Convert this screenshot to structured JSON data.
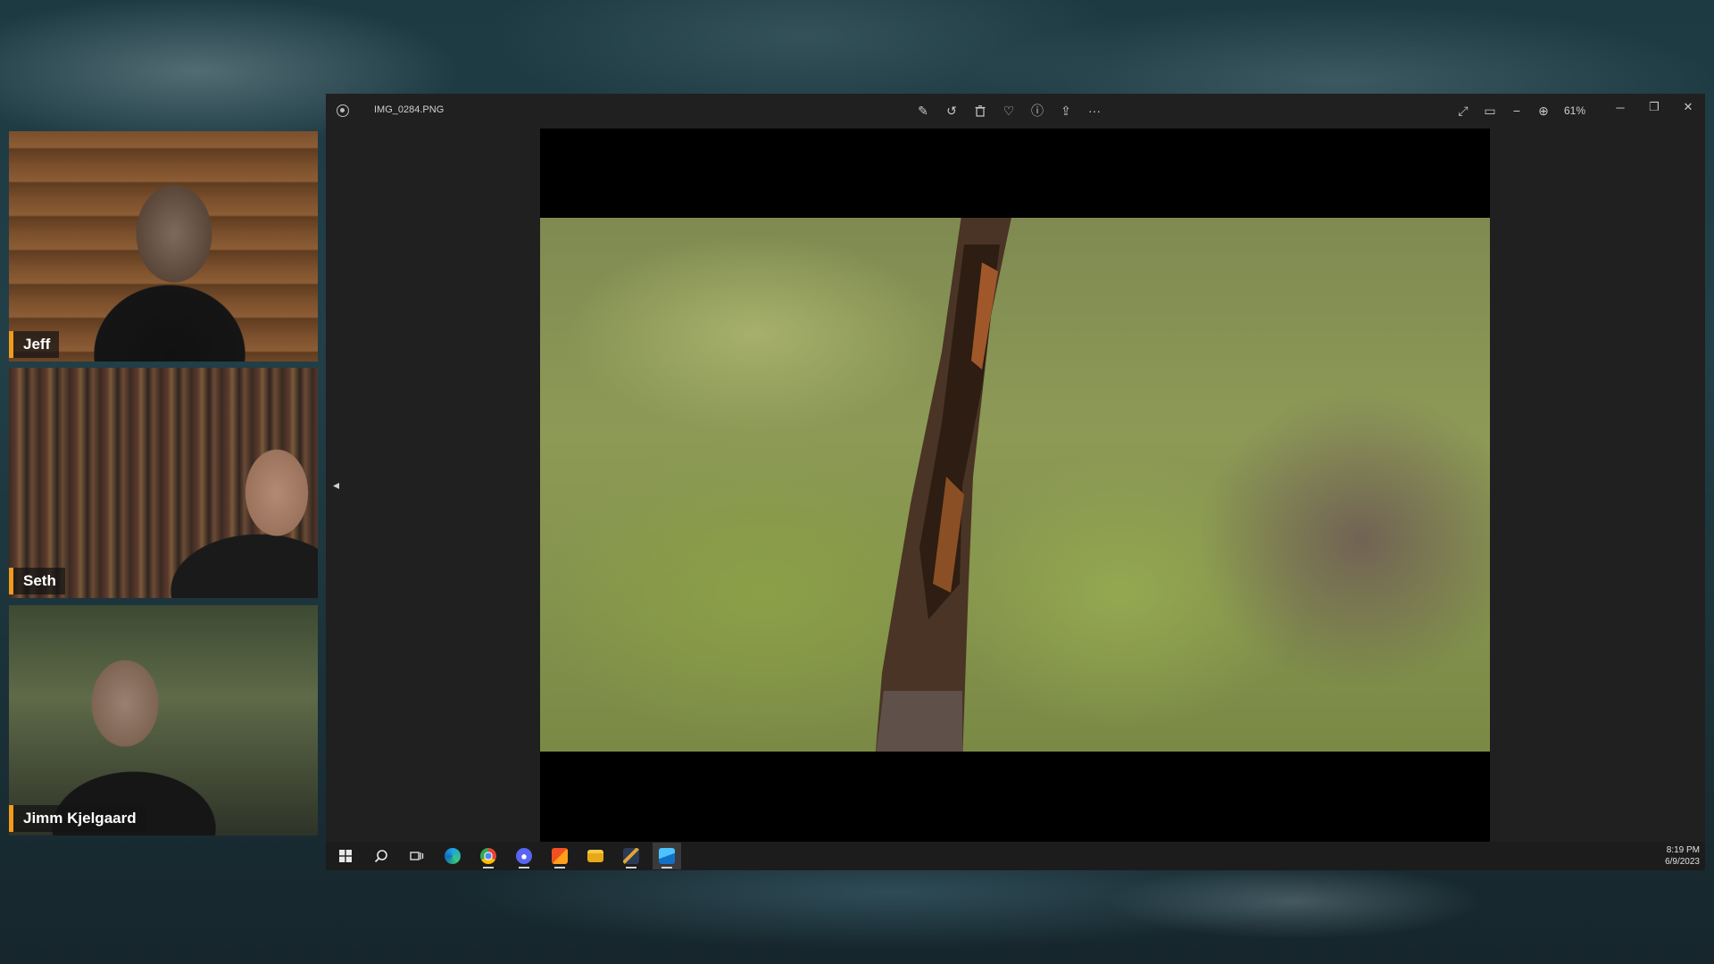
{
  "participants": [
    {
      "name": "Jeff"
    },
    {
      "name": "Seth"
    },
    {
      "name": "Jimm Kjelgaard"
    }
  ],
  "photos_app": {
    "file_name": "IMG_0284.PNG",
    "zoom": "61%",
    "toolbar_icons": [
      "edit-image-icon",
      "rotate-icon",
      "delete-icon",
      "favorite-icon",
      "info-icon",
      "share-icon",
      "more-icon"
    ],
    "toolbar_glyphs": {
      "edit": "✎",
      "rotate": "↺",
      "delete": "🗑",
      "favorite": "♡",
      "info": "ⓘ",
      "share": "⇪",
      "more": "···",
      "fullscreen": "⤢",
      "fit": "▭",
      "zoom_out": "−",
      "zoom_in": "⊕",
      "back": "◂"
    },
    "window_controls": {
      "minimize": "─",
      "maximize": "❐",
      "close": "✕"
    }
  },
  "taskbar": {
    "time": "8:19 PM",
    "date": "6/9/2023",
    "apps": [
      "start",
      "search",
      "task-view",
      "edge",
      "chrome",
      "discord",
      "store",
      "file-explorer",
      "app-7",
      "photos"
    ]
  },
  "colors": {
    "name_tag_accent": "#f29a1c",
    "window_bg": "#202020",
    "taskbar_bg": "#1c1c1c"
  }
}
